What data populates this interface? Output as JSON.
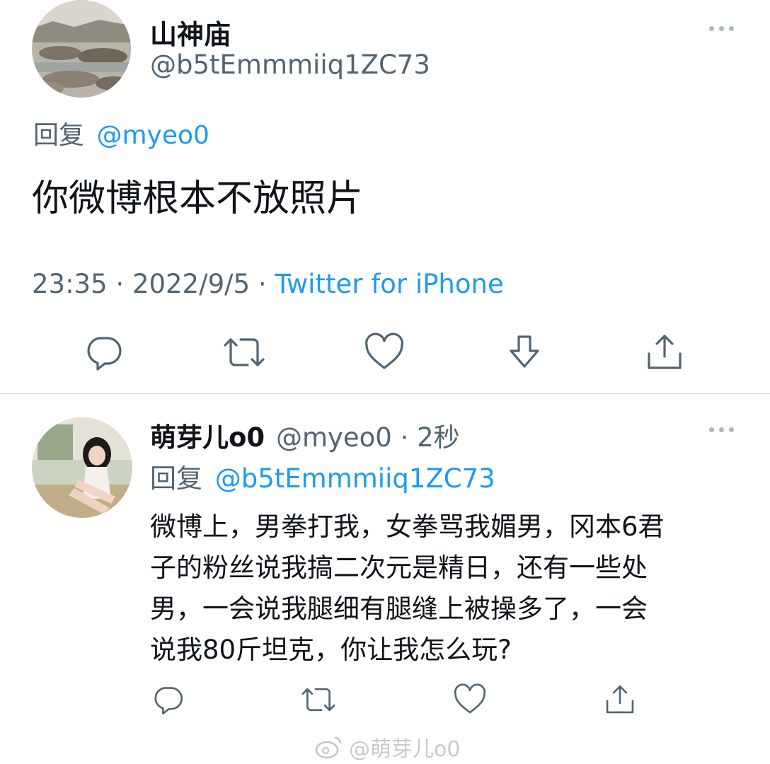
{
  "main_tweet": {
    "display_name": "山神庙",
    "handle": "@b5tEmmmiiq1ZC73",
    "reply_prefix": "回复",
    "reply_to": "@myeo0",
    "text": "你微博根本不放照片",
    "time": "23:35",
    "separator": "·",
    "date": "2022/9/5",
    "source": "Twitter for iPhone",
    "actions": [
      "reply-icon",
      "retweet-icon",
      "like-icon",
      "download-icon",
      "share-icon"
    ]
  },
  "reply_tweet": {
    "display_name": "萌芽儿o0",
    "handle": "@myeo0",
    "separator": "·",
    "age": "2秒",
    "reply_prefix": "回复",
    "reply_to": "@b5tEmmmiiq1ZC73",
    "lines": [
      "微博上，男拳打我，女拳骂我媚男，冈本6君",
      "子的粉丝说我搞二次元是精日，还有一些处",
      "男，一会说我腿细有腿缝上被操多了，一会",
      "说我80斤坦克，你让我怎么玩?"
    ],
    "actions": [
      "reply-icon",
      "retweet-icon",
      "like-icon",
      "share-icon"
    ]
  },
  "watermark": {
    "text": "@萌芽儿o0",
    "icon": "weibo-logo-icon"
  },
  "colors": {
    "link": "#1d9bf0",
    "secondary_text": "#536471",
    "primary_text": "#0f1419"
  }
}
